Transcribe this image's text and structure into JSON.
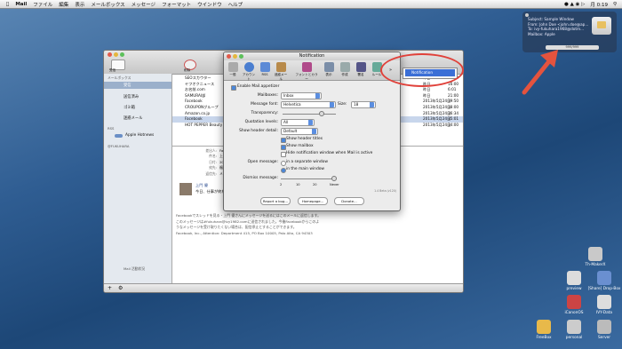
{
  "menubar": {
    "apple": "",
    "app": "Mail",
    "items": [
      "ファイル",
      "編集",
      "表示",
      "メールボックス",
      "メッセージ",
      "フォーマット",
      "ウインドウ",
      "ヘルプ"
    ],
    "clock": "月 0:19"
  },
  "growl": {
    "line1": "Subject: Sample Window",
    "line2": "From: John Doe <john.doe@ap...",
    "line3": "To: ivy-fukuhara1968@dotm...",
    "line4": "Mailbox: Apple",
    "counter": "999/999"
  },
  "mail": {
    "toolbar": {
      "btn1": "受信",
      "btn2": "削除"
    },
    "sidebar": {
      "section1": "メールボックス",
      "inbox": "受信",
      "sent": "送信済み",
      "trash": "ゴミ箱",
      "junk": "迷惑メール",
      "rss": "RSS",
      "rss_feed": "Apple Hotnews",
      "account": "@FUKUHARA",
      "footer": "Mail 活動状況"
    },
    "list": [
      {
        "subject": "SEOスカウター",
        "date": ""
      },
      {
        "subject": "ヤフオクニュース",
        "date": ""
      },
      {
        "subject": "お名前.com",
        "date": ""
      },
      {
        "subject": "SAMURAI部",
        "date": ""
      },
      {
        "subject": "Facebook",
        "date": "2013年5月24日"
      },
      {
        "subject": "CROUPONグループ",
        "date": "2013年5月24日"
      },
      {
        "subject": "Amazon.co.jp",
        "date": "2013年5月24日"
      },
      {
        "subject": "Facebook",
        "date": "2013年5月24日"
      },
      {
        "subject": "HOT PEPPER Beauty",
        "date": "2013年5月24日"
      }
    ],
    "list_right": [
      "昨日",
      "昨日",
      "昨日",
      "昨日"
    ],
    "list_times": [
      "20:00",
      "16:00",
      "6:01",
      "21:00",
      "19:50",
      "18:00",
      "16:34",
      "15:01",
      "14:00"
    ],
    "preview": {
      "from_label": "差出人:",
      "from": "Facebook <notifica",
      "subject_label": "件名:",
      "subject": "上門 優さんからの",
      "date_label": "日付:",
      "date": "2013年5月24日 1",
      "to_label": "宛先:",
      "to": "福原 雅司 <fukuhar",
      "reply_label": "返信先:",
      "reply": "メールで返信 noti",
      "sender": "上門 優",
      "snippet": "今日、仕事が終わ",
      "body1": "Facebookでスレッドを見る・上門 優さんにメッセージを送るにはこのメールに返信します。",
      "body2": "このメッセージは#fukuhara@ivy1982.comに送信されました。今後Facebookからこのよ",
      "body3": "うなメッセージを受け取りたくない場合は、配信停止とすることができます。",
      "body4": "Facebook, Inc., Attention: Department 415, PO Box 10005, Palo Alto, CA 94303"
    }
  },
  "dialog": {
    "title": "Notification",
    "tools": [
      "一般",
      "アカウント",
      "RSS",
      "迷惑メール",
      "フォントとカラー",
      "表示",
      "作成",
      "署名",
      "ルール"
    ],
    "enable": "Enable Mail.appetizer",
    "mailboxes_label": "Mailboxes:",
    "mailboxes_value": "Inbox",
    "font_label": "Message font:",
    "font_value": "Helvetica",
    "size_label": "Size:",
    "size_value": "18",
    "transparency_label": "Transparency:",
    "quotation_label": "Quotation levels:",
    "quotation_value": "All",
    "header_label": "Show header detail:",
    "header_value": "Default",
    "opt1": "Show header titles",
    "opt2": "Show mailbox",
    "opt3": "Hide notification window when Mail is active",
    "open_label": "Open message:",
    "open1": "in a separate window",
    "open2": "in the main window",
    "dismiss_label": "Dismiss message:",
    "ticks": [
      "2",
      "10",
      "20",
      "Never"
    ],
    "version": "1.4 Beta (v120)",
    "btn_bug": "Report a bug...",
    "btn_home": "Homepage...",
    "btn_donate": "Donate..."
  },
  "popup": {
    "item": "Notification"
  },
  "desktop": [
    {
      "label": "Th-MakerX"
    },
    {
      "label": "preview"
    },
    {
      "label": "[Share] Drop-Box"
    },
    {
      "label": "iCanonOS"
    },
    {
      "label": "IVY-Data"
    },
    {
      "label": "FreeBox"
    },
    {
      "label": "personal"
    },
    {
      "label": "Server"
    }
  ]
}
